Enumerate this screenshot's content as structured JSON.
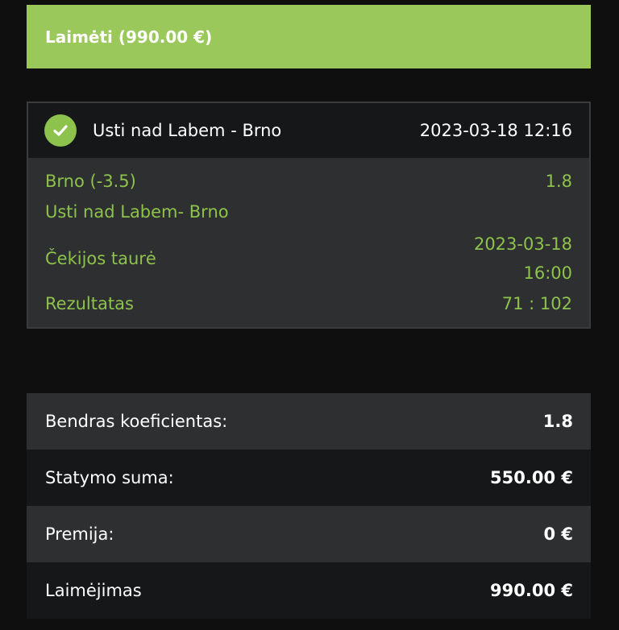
{
  "status_banner": {
    "label": "Laimėti (990.00 €)"
  },
  "event": {
    "status_icon": "check-circle-icon",
    "title": "Usti nad Labem - Brno",
    "datetime": "2023-03-18 12:16",
    "pick": "Brno (-3.5)",
    "odds": "1.8",
    "match": "Usti nad Labem- Brno",
    "league": "Čekijos taurė",
    "match_date": "2023-03-18",
    "match_time": "16:00",
    "result_label": "Rezultatas",
    "result_value": "71 : 102"
  },
  "summary": {
    "rows": [
      {
        "label": "Bendras koeficientas:",
        "value": "1.8"
      },
      {
        "label": "Statymo suma:",
        "value": "550.00 €"
      },
      {
        "label": "Premija:",
        "value": "0 €"
      },
      {
        "label": "Laimėjimas",
        "value": "990.00 €"
      }
    ]
  },
  "colors": {
    "banner_green": "#9bc85a",
    "accent_green": "#8dc24c",
    "background": "#0f0f0f",
    "row_light": "#2e2f31",
    "row_dark": "#161719"
  }
}
